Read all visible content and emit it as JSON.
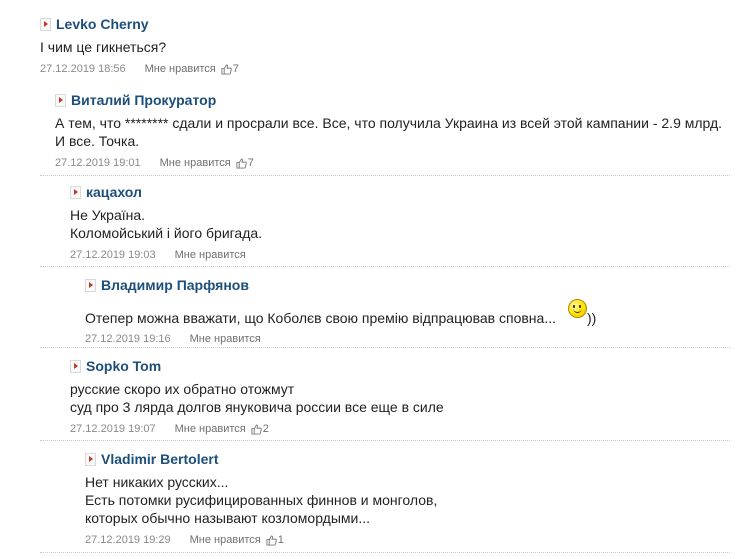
{
  "comments": [
    {
      "author": "Levko Cherny",
      "lines": [
        "І чим це гикнеться?"
      ],
      "date": "27.12.2019 18:56",
      "like_label": "Мне нравится",
      "likes": "7"
    },
    {
      "author": "Виталий Прокуратор",
      "lines": [
        "А тем, что ******** сдали и просрали все. Все, что получила Украина из всей этой кампании - 2.9 млрд.",
        "И все. Точка."
      ],
      "date": "27.12.2019 19:01",
      "like_label": "Мне нравится",
      "likes": "7"
    },
    {
      "author": "кацахол",
      "lines": [
        "Не Україна.",
        "Коломойський і його бригада."
      ],
      "date": "27.12.2019 19:03",
      "like_label": "Мне нравится",
      "likes": ""
    },
    {
      "author": "Владимир Парфянов",
      "lines": [
        "Отепер можна вважати, що Коболєв свою премію відпрацював сповна..."
      ],
      "suffix": "))",
      "date": "27.12.2019 19:16",
      "like_label": "Мне нравится",
      "likes": ""
    },
    {
      "author": "Sopko Tom",
      "lines": [
        "русские скоро их обратно отожмут",
        "суд про 3 лярда долгов януковича россии все еще в силе"
      ],
      "date": "27.12.2019 19:07",
      "like_label": "Мне нравится",
      "likes": "2"
    },
    {
      "author": "Vladimir Bertolert",
      "lines": [
        "Нет никаких русских...",
        "Есть потомки русифицированных финнов и монголов,",
        "которых обычно называют козломордыми..."
      ],
      "date": "27.12.2019 19:29",
      "like_label": "Мне нравится",
      "likes": "1"
    }
  ],
  "icons": {
    "author_marker": "arrow-right-icon",
    "like": "thumbs-up-icon",
    "emoticon": "smiley-icon"
  },
  "colors": {
    "author": "#1c4f7a",
    "text": "#222222",
    "meta": "#8a8a8a",
    "marker_arrow": "#c0392b",
    "separator": "#c8c8c8"
  }
}
